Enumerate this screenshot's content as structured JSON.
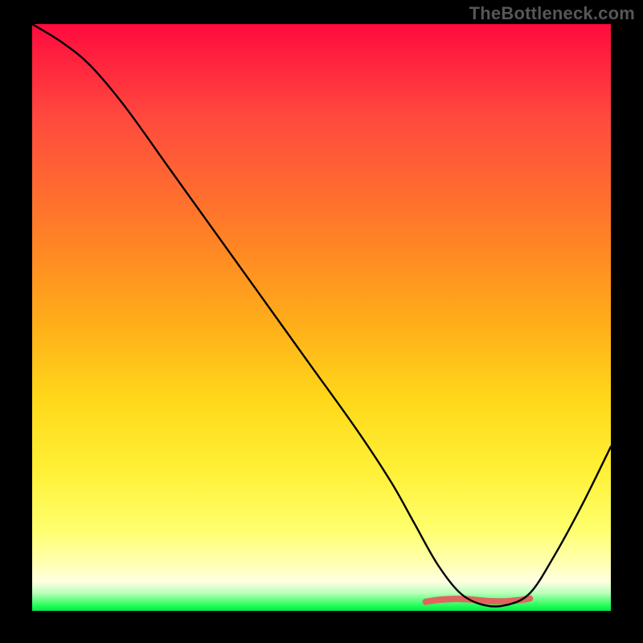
{
  "attribution": "TheBottleneck.com",
  "chart_data": {
    "type": "line",
    "title": "",
    "xlabel": "",
    "ylabel": "",
    "xlim": [
      0,
      100
    ],
    "ylim": [
      0,
      100
    ],
    "grid": false,
    "series": [
      {
        "name": "bottleneck-curve",
        "x": [
          0,
          5,
          10,
          16,
          24,
          32,
          40,
          48,
          56,
          62,
          66,
          70,
          74,
          78,
          82,
          86,
          90,
          95,
          100
        ],
        "values": [
          100,
          97,
          93,
          86,
          75,
          64,
          53,
          42,
          31,
          22,
          15,
          8,
          3,
          1,
          1,
          3,
          9,
          18,
          28
        ]
      }
    ],
    "annotations": [
      {
        "name": "valley-highlight",
        "x_range": [
          68,
          86
        ],
        "y": 1,
        "color": "#e0655f"
      }
    ],
    "colors": {
      "gradient_top": "#ff0b3e",
      "gradient_mid": "#ffd81a",
      "gradient_bottom": "#00e84a",
      "curve": "#000000",
      "highlight": "#e0655f",
      "background_frame": "#000000"
    }
  }
}
